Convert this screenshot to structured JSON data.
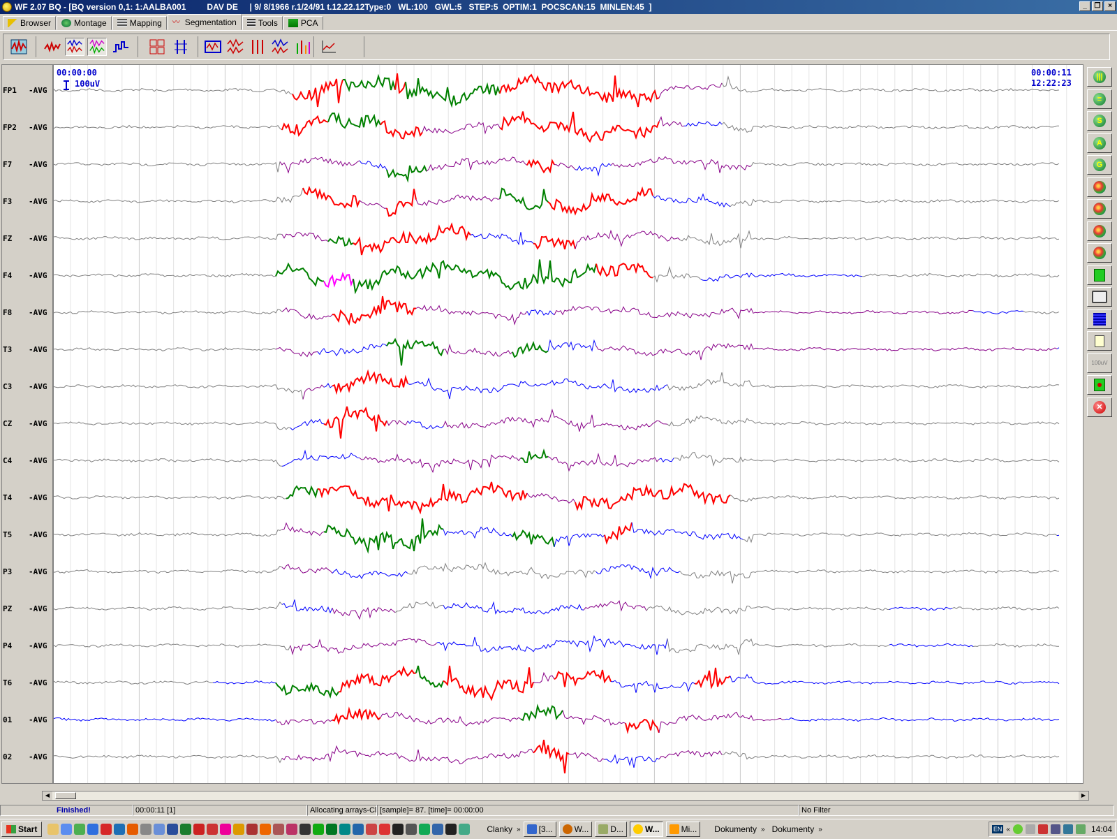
{
  "window": {
    "title": "WF 2.07 BQ - [BQ version 0,1: 1:AALBA001         DAV DE     | 9/ 8/1966 r.1/24/91 t.12.22.12Type:0   WL:100   GWL:5   STEP:5  OPTIM:1  POCSCAN:15  MINLEN:45  ]"
  },
  "tabs": [
    {
      "label": "Browser"
    },
    {
      "label": "Montage"
    },
    {
      "label": "Mapping"
    },
    {
      "label": "Segmentation"
    },
    {
      "label": "Tools"
    },
    {
      "label": "PCA"
    }
  ],
  "eeg": {
    "time_start": "00:00:00",
    "time_end": "00:00:11",
    "clock": "12:22:23",
    "scale_label": "100uV",
    "reference": "-AVG",
    "channels": [
      "FP1",
      "FP2",
      "F7",
      "F3",
      "FZ",
      "F4",
      "F8",
      "T3",
      "C3",
      "CZ",
      "C4",
      "T4",
      "T5",
      "P3",
      "PZ",
      "P4",
      "T6",
      "01",
      "02"
    ],
    "segment_colors": {
      "red": "#ff0000",
      "green": "#008000",
      "purple": "#880088",
      "blue": "#0000ff",
      "magenta": "#ff00ff",
      "gray": "#808080"
    }
  },
  "sidebar": {
    "buttons": [
      {
        "icon": "bars-vertical-icon",
        "glyph": "|||"
      },
      {
        "icon": "bars-horizontal-icon",
        "glyph": "≡"
      },
      {
        "icon": "s-icon",
        "glyph": "S"
      },
      {
        "icon": "a-icon",
        "glyph": "A"
      },
      {
        "icon": "g-icon",
        "glyph": "G"
      },
      {
        "icon": "head-map-icon",
        "glyph": ""
      },
      {
        "icon": "head-map-icon",
        "glyph": ""
      },
      {
        "icon": "head-map-icon",
        "glyph": ""
      },
      {
        "icon": "head-map-icon",
        "glyph": ""
      },
      {
        "icon": "green-square-icon",
        "glyph": ""
      },
      {
        "icon": "printer-icon",
        "glyph": ""
      },
      {
        "icon": "blue-grid-icon",
        "glyph": ""
      },
      {
        "icon": "document-icon",
        "glyph": ""
      },
      {
        "icon": "scale-icon",
        "glyph": "100uV"
      },
      {
        "icon": "record-icon",
        "glyph": ""
      },
      {
        "icon": "close-icon",
        "glyph": "✕"
      }
    ]
  },
  "status": {
    "state": "Finished!",
    "time": "00:00:11 [1]",
    "message": "Allocating arrays-Cl",
    "sample": "[sample]=   87.  [time]= 00:00:00",
    "filter": "No Filter"
  },
  "taskbar": {
    "start": "Start",
    "folder": "Clanky",
    "tasks": [
      "[3...",
      "W...",
      "D...",
      "W...",
      "Mi..."
    ],
    "documents": [
      "Dokumenty",
      "Dokumenty"
    ],
    "lang": "EN",
    "clock": "14:04"
  }
}
